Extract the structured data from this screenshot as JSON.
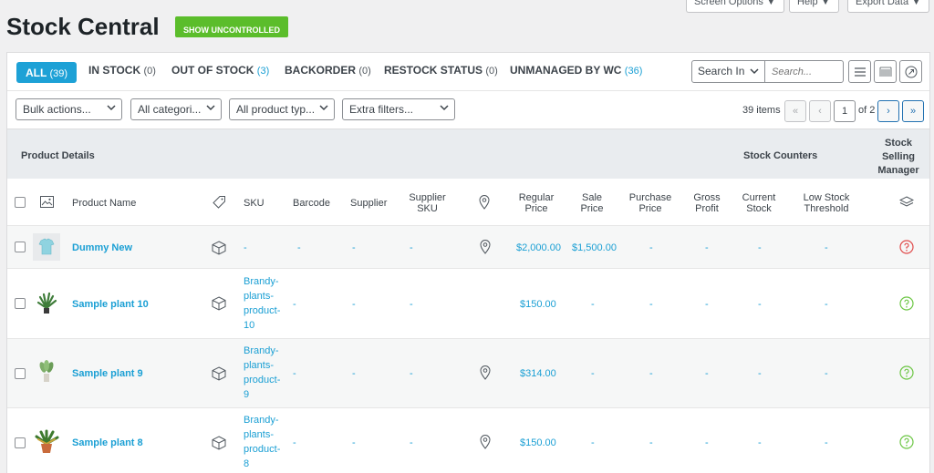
{
  "screen_options": {
    "screen_options_label": "Screen Options ▼",
    "help_label": "Help ▼",
    "export_label": "Export Data ▼"
  },
  "header": {
    "title": "Stock Central",
    "show_uncontrolled": "SHOW UNCONTROLLED"
  },
  "status_tabs": [
    {
      "label": "ALL",
      "count": "(39)"
    },
    {
      "label": "IN STOCK",
      "count": "(0)"
    },
    {
      "label": "OUT OF STOCK",
      "count": "(3)"
    },
    {
      "label": "BACKORDER",
      "count": "(0)"
    },
    {
      "label": "RESTOCK STATUS",
      "count": "(0)"
    },
    {
      "label": "UNMANAGED BY WC",
      "count": "(36)"
    }
  ],
  "search": {
    "search_in": "Search In",
    "placeholder": "Search..."
  },
  "filters": {
    "bulk_actions": "Bulk actions...",
    "categories": "All categori...",
    "product_types": "All product typ...",
    "extra_filters": "Extra filters..."
  },
  "pagination": {
    "items": "39 items",
    "first": "«",
    "prev": "‹",
    "current": "1",
    "of": "of 2",
    "next": "›",
    "last": "»"
  },
  "group_headers": {
    "product_details": "Product Details",
    "stock_counters": "Stock Counters",
    "stock_selling_manager_1": "Stock",
    "stock_selling_manager_2": "Selling",
    "stock_selling_manager_3": "Manager"
  },
  "columns": {
    "product_name": "Product Name",
    "sku": "SKU",
    "barcode": "Barcode",
    "supplier": "Supplier",
    "supplier_sku_1": "Supplier",
    "supplier_sku_2": "SKU",
    "regular_price_1": "Regular",
    "regular_price_2": "Price",
    "sale_price_1": "Sale",
    "sale_price_2": "Price",
    "purchase_price_1": "Purchase",
    "purchase_price_2": "Price",
    "gross_profit_1": "Gross",
    "gross_profit_2": "Profit",
    "current_stock_1": "Current",
    "current_stock_2": "Stock",
    "low_stock_1": "Low Stock",
    "low_stock_2": "Threshold"
  },
  "rows": [
    {
      "name": "Dummy New",
      "sku_lines": [
        "-"
      ],
      "barcode": "-",
      "supplier": "-",
      "supplier_sku": "-",
      "regular_price": "$2,000.00",
      "sale_price": "$1,500.00",
      "purchase_price": "-",
      "gross_profit": "-",
      "current_stock": "-",
      "low_stock": "-",
      "status_color": "#e04b4b"
    },
    {
      "name": "Sample plant 10",
      "sku_lines": [
        "Brandy-",
        "plants-",
        "product-",
        "10"
      ],
      "barcode": "-",
      "supplier": "-",
      "supplier_sku": "-",
      "regular_price": "$150.00",
      "sale_price": "-",
      "purchase_price": "-",
      "gross_profit": "-",
      "current_stock": "-",
      "low_stock": "-",
      "status_color": "#6cc644"
    },
    {
      "name": "Sample plant 9",
      "sku_lines": [
        "Brandy-",
        "plants-",
        "product-",
        "9"
      ],
      "barcode": "-",
      "supplier": "-",
      "supplier_sku": "-",
      "regular_price": "$314.00",
      "sale_price": "-",
      "purchase_price": "-",
      "gross_profit": "-",
      "current_stock": "-",
      "low_stock": "-",
      "status_color": "#6cc644"
    },
    {
      "name": "Sample plant 8",
      "sku_lines": [
        "Brandy-",
        "plants-",
        "product-",
        "8"
      ],
      "barcode": "-",
      "supplier": "-",
      "supplier_sku": "-",
      "regular_price": "$150.00",
      "sale_price": "-",
      "purchase_price": "-",
      "gross_profit": "-",
      "current_stock": "-",
      "low_stock": "-",
      "status_color": "#6cc644"
    }
  ]
}
